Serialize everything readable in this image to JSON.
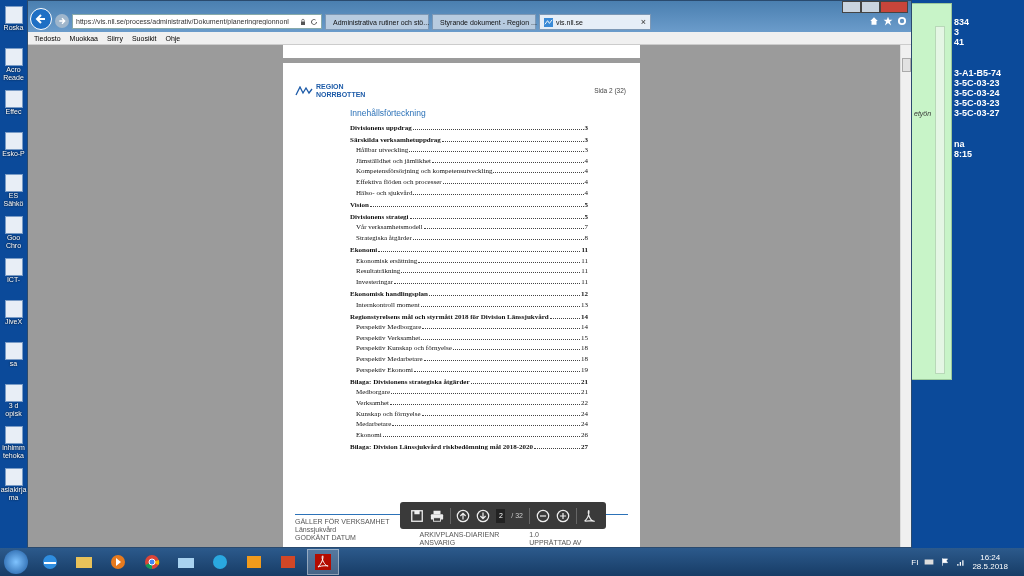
{
  "desktop_icons": [
    {
      "lines": [
        "Roska"
      ]
    },
    {
      "lines": [
        "Acro",
        "Reade"
      ]
    },
    {
      "lines": [
        "Effec"
      ]
    },
    {
      "lines": [
        "Esko-P"
      ]
    },
    {
      "lines": [
        "ES",
        "Sähkö"
      ]
    },
    {
      "lines": [
        "Goo",
        "Chro"
      ]
    },
    {
      "lines": [
        "ICT-"
      ]
    },
    {
      "lines": [
        "JiveX"
      ]
    },
    {
      "lines": [
        "sa"
      ]
    },
    {
      "lines": [
        "3 d",
        "opisk"
      ]
    },
    {
      "lines": [
        "inhimm",
        "tehoka"
      ]
    },
    {
      "lines": [
        "asiakirja",
        "ma"
      ]
    }
  ],
  "desktop_text": [
    [
      "834",
      "3",
      "41"
    ],
    [
      "3-A1-B5-74",
      "3-5C-03-23",
      "3-5C-03-24",
      "3-5C-03-23",
      "3-5C-03-27"
    ],
    [
      "na",
      "8:15"
    ]
  ],
  "side_window": {
    "text": "etyön"
  },
  "browser": {
    "address": "https://vis.nll.se/process/administrativ/Dokument/planeringregionnonl",
    "tabs": [
      {
        "label": "Administrativa rutiner och stö...",
        "selected": false
      },
      {
        "label": "Styrande dokument - Region ...",
        "selected": false
      },
      {
        "label": "vis.nll.se",
        "selected": true,
        "close": "×"
      }
    ],
    "menu": [
      "Tiedosto",
      "Muokkaa",
      "Siirry",
      "Suosikit",
      "Ohje"
    ]
  },
  "document": {
    "logo_lines": [
      "REGION",
      "NORRBOTTEN"
    ],
    "page_label": "Sida 2 (32)",
    "toc_title": "Innehållsförteckning",
    "toc": [
      {
        "title": "Divisionens uppdrag",
        "page": "3"
      },
      {
        "title": "Särskilda verksamhetuppdrag",
        "page": "3",
        "children": [
          {
            "title": "Hållbar utveckling",
            "page": "3"
          },
          {
            "title": "Jämställdhet och jämlikhet",
            "page": "4"
          },
          {
            "title": "Kompetensförsörjning och kompetensutveckling",
            "page": "4"
          },
          {
            "title": "Effektiva flöden och processer",
            "page": "4"
          },
          {
            "title": "Hälso- och sjukvård",
            "page": "4"
          }
        ]
      },
      {
        "title": "Vision",
        "page": "5"
      },
      {
        "title": "Divisionens strategi",
        "page": "5",
        "children": [
          {
            "title": "Vår verksamhetsmodell",
            "page": "7"
          },
          {
            "title": "Strategiska åtgärder",
            "page": "8"
          }
        ]
      },
      {
        "title": "Ekonomi",
        "page": "11",
        "children": [
          {
            "title": "Ekonomisk ersättning",
            "page": "11"
          },
          {
            "title": "Resultaträkning",
            "page": "11"
          },
          {
            "title": "Investeringar",
            "page": "11"
          }
        ]
      },
      {
        "title": "Ekonomisk handlingsplan",
        "page": "12",
        "children": [
          {
            "title": "Internkontroll moment",
            "page": "13"
          }
        ]
      },
      {
        "title": "Regionstyrelsens mål och styrmått 2018 för Division Länssjukvård",
        "page": "14",
        "children": [
          {
            "title": "Perspektiv Medborgare",
            "page": "14"
          },
          {
            "title": "Perspektiv Verksamhet",
            "page": "15"
          },
          {
            "title": "Perspektiv Kunskap och förnyelse",
            "page": "18"
          },
          {
            "title": "Perspektiv Medarbetare",
            "page": "18"
          },
          {
            "title": "Perspektiv Ekonomi",
            "page": "19"
          }
        ]
      },
      {
        "title": "Bilaga: Divisionens strategiska åtgärder",
        "page": "21",
        "children": [
          {
            "title": "Medborgare",
            "page": "21"
          },
          {
            "title": "Verksamhet",
            "page": "22"
          },
          {
            "title": "Kunskap och förnyelse",
            "page": "24"
          },
          {
            "title": "Medarbetare",
            "page": "24"
          },
          {
            "title": "Ekonomi",
            "page": "26"
          }
        ]
      },
      {
        "title": "Bilaga: Division Länssjukvård riskbedömning mål 2018-2020",
        "page": "27"
      }
    ],
    "footer": [
      [
        "GÄLLER FÖR VERKSAMHET",
        "Länssjukvård",
        "GODKÄNT DATUM"
      ],
      [
        "ARKIVPLANS-DIARIENR",
        "ANSVARIG"
      ],
      [
        "1.0",
        "UPPRÄTTAD AV"
      ]
    ]
  },
  "pdf_toolbar": {
    "page": "2",
    "total": "/ 32"
  },
  "taskbar": {
    "language": "FI",
    "time": "16:24",
    "date": "28.5.2018"
  }
}
